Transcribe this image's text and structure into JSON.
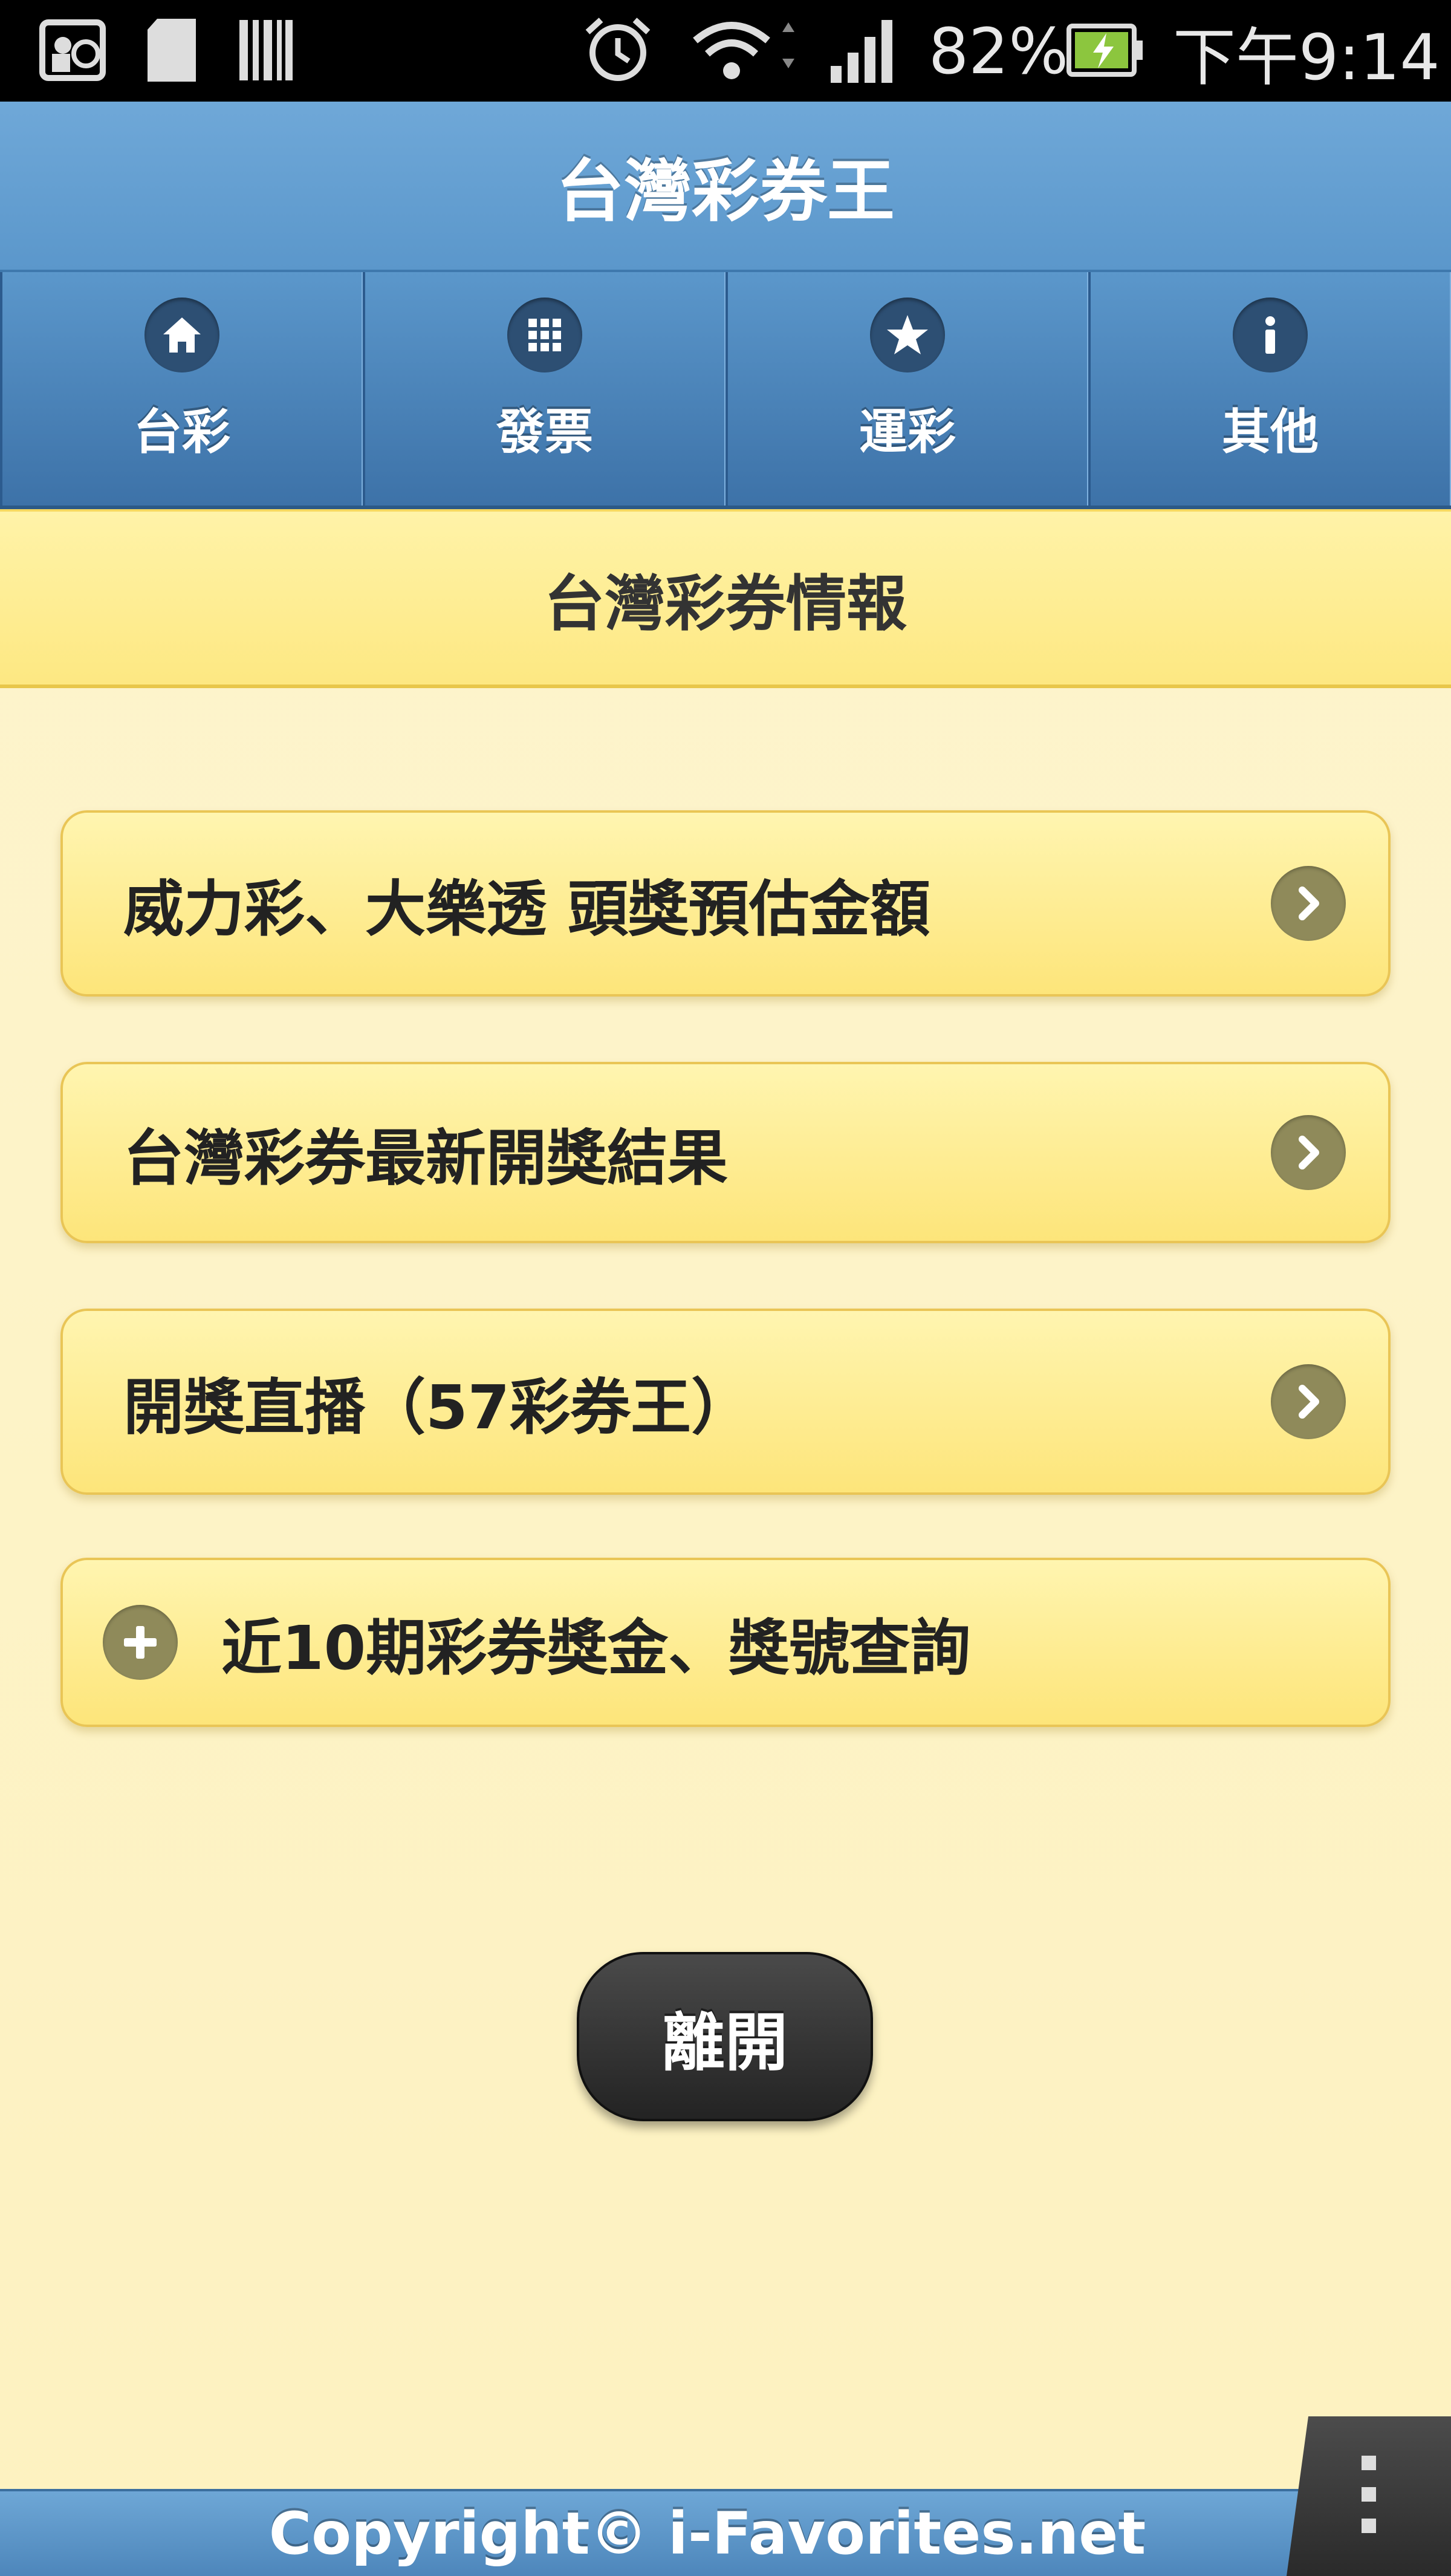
{
  "status_bar": {
    "battery": "82%",
    "time": "下午9:14",
    "icons": [
      "photo-icon",
      "sd-card-icon",
      "barcode-icon",
      "alarm-icon",
      "wifi-icon",
      "signal-icon",
      "battery-charging-icon"
    ]
  },
  "header": {
    "title": "台灣彩券王"
  },
  "nav": {
    "tabs": [
      {
        "label": "台彩",
        "icon": "home-icon"
      },
      {
        "label": "發票",
        "icon": "grid-icon"
      },
      {
        "label": "運彩",
        "icon": "star-icon"
      },
      {
        "label": "其他",
        "icon": "info-icon"
      }
    ]
  },
  "section": {
    "title": "台灣彩券情報"
  },
  "menu": {
    "items": [
      {
        "label": "威力彩、大樂透 頭獎預估金額",
        "icon": "chevron-right-icon"
      },
      {
        "label": "台灣彩券最新開獎結果",
        "icon": "chevron-right-icon"
      },
      {
        "label": "開獎直播（57彩券王）",
        "icon": "chevron-right-icon"
      },
      {
        "label": "近10期彩券獎金、獎號查詢",
        "icon": "plus-icon"
      }
    ]
  },
  "leave_button": {
    "label": "離開"
  },
  "footer": {
    "copyright": "Copyright© i-Favorites.net"
  },
  "colors": {
    "header_blue": "#5b97cb",
    "section_yellow": "#fde882",
    "button_yellow": "#fde57a",
    "icon_olive": "#8f8a5a",
    "leave_dark": "#232323"
  }
}
